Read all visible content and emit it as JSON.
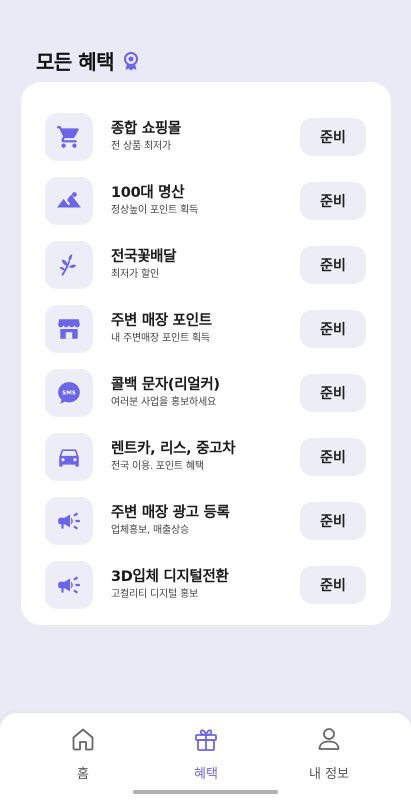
{
  "header": {
    "title": "모든 혜택",
    "badge_icon": "award-badge-icon"
  },
  "accent_color": "#6d65e8",
  "benefits": [
    {
      "icon": "shopping-cart-icon",
      "title": "종합 쇼핑몰",
      "subtitle": "전 상품 최저가",
      "button": "준비"
    },
    {
      "icon": "mountain-icon",
      "title": "100대 명산",
      "subtitle": "정상높이 포인트 획득",
      "button": "준비"
    },
    {
      "icon": "flower-icon",
      "title": "전국꽃배달",
      "subtitle": "최저가 할인",
      "button": "준비"
    },
    {
      "icon": "store-icon",
      "title": "주변 매장 포인트",
      "subtitle": "내 주변매장 포인트 획득",
      "button": "준비"
    },
    {
      "icon": "sms-icon",
      "title": "콜백 문자(리얼커)",
      "subtitle": "여러분 사업을 홍보하세요",
      "button": "준비"
    },
    {
      "icon": "car-icon",
      "title": "렌트카, 리스, 중고차",
      "subtitle": "전국 이용. 포인트 혜택",
      "button": "준비"
    },
    {
      "icon": "megaphone-icon",
      "title": "주변 매장 광고 등록",
      "subtitle": "업체홍보, 매출상승",
      "button": "준비"
    },
    {
      "icon": "megaphone-icon",
      "title": "3D입체 디지털전환",
      "subtitle": "고컬리티 디지털 홍보",
      "button": "준비"
    }
  ],
  "nav": {
    "items": [
      {
        "icon": "home-icon",
        "label": "홈",
        "active": false
      },
      {
        "icon": "gift-icon",
        "label": "혜택",
        "active": true
      },
      {
        "icon": "profile-icon",
        "label": "내 정보",
        "active": false
      }
    ]
  }
}
